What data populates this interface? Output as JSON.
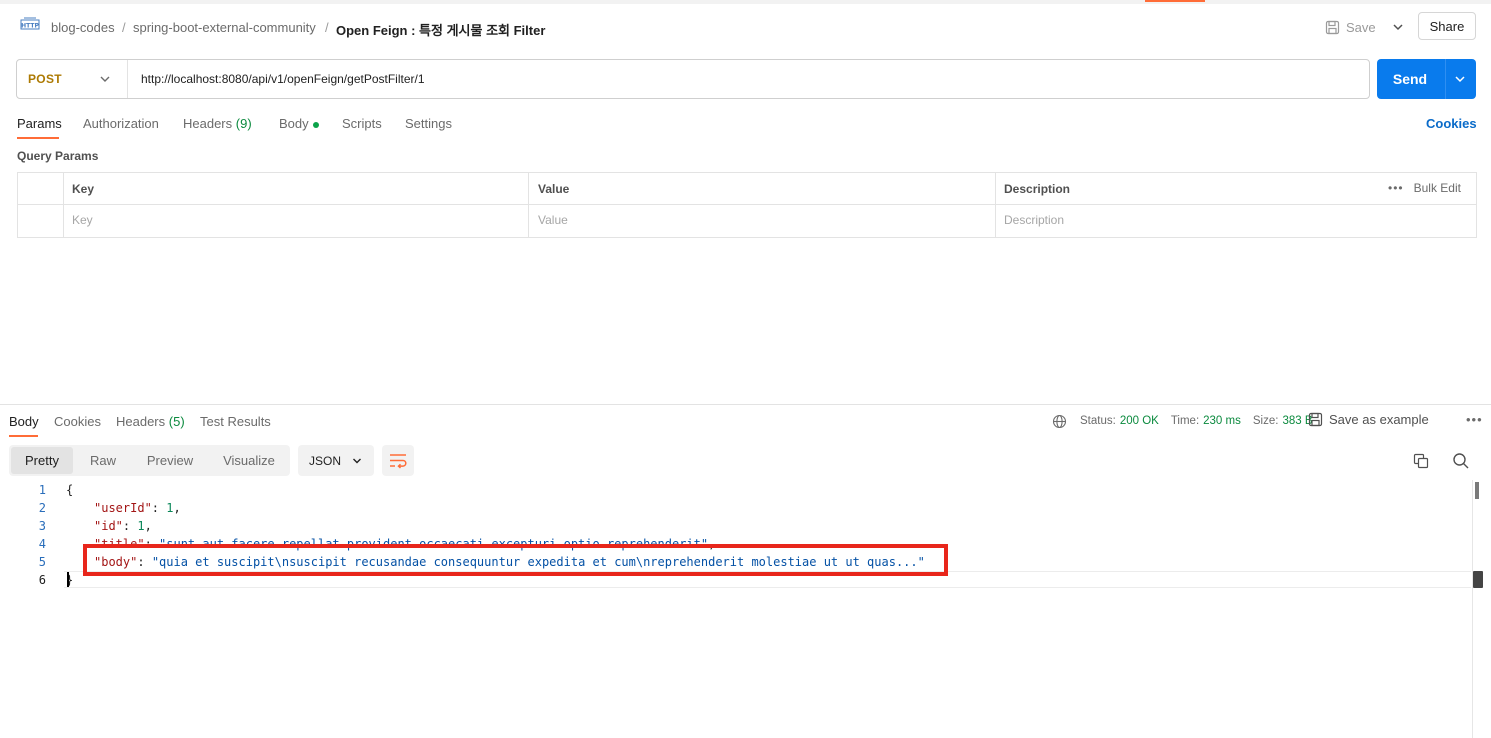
{
  "breadcrumb": {
    "items": [
      "blog-codes",
      "spring-boot-external-community"
    ],
    "separator": "/",
    "current": "Open Feign : 특정 게시물 조회 Filter"
  },
  "toolbar": {
    "save_label": "Save",
    "share_label": "Share"
  },
  "request": {
    "method": "POST",
    "url": "http://localhost:8080/api/v1/openFeign/getPostFilter/1",
    "send_label": "Send"
  },
  "request_tabs": {
    "params": "Params",
    "authorization": "Authorization",
    "headers_label": "Headers",
    "headers_count": "(9)",
    "body": "Body",
    "scripts": "Scripts",
    "settings": "Settings",
    "cookies": "Cookies"
  },
  "query_params": {
    "title": "Query Params",
    "headers": {
      "key": "Key",
      "value": "Value",
      "description": "Description"
    },
    "placeholders": {
      "key": "Key",
      "value": "Value",
      "description": "Description"
    },
    "bulk_edit": "Bulk Edit"
  },
  "response_tabs": {
    "body": "Body",
    "cookies": "Cookies",
    "headers_label": "Headers",
    "headers_count": "(5)",
    "test_results": "Test Results"
  },
  "response_meta": {
    "status_label": "Status:",
    "status_value": "200 OK",
    "time_label": "Time:",
    "time_value": "230 ms",
    "size_label": "Size:",
    "size_value": "383 B",
    "save_example": "Save as example"
  },
  "view_modes": {
    "pretty": "Pretty",
    "raw": "Raw",
    "preview": "Preview",
    "visualize": "Visualize",
    "format": "JSON"
  },
  "code": {
    "line_numbers": [
      "1",
      "2",
      "3",
      "4",
      "5",
      "6"
    ],
    "open_brace": "{",
    "close_brace": "}",
    "lines": [
      {
        "key": "\"userId\"",
        "sep": ": ",
        "value": "1",
        "end": ","
      },
      {
        "key": "\"id\"",
        "sep": ": ",
        "value": "1",
        "end": ","
      },
      {
        "key": "\"title\"",
        "sep": ": ",
        "value": "\"sunt aut facere repellat provident occaecati excepturi optio reprehenderit\"",
        "end": ","
      },
      {
        "key": "\"body\"",
        "sep": ": ",
        "value": "\"quia et suscipit\\nsuscipit recusandae consequuntur expedita et cum\\nreprehenderit molestiae ut ut quas...\"",
        "end": ""
      }
    ]
  },
  "colors": {
    "accent": "#ff6c37",
    "send": "#097bed",
    "method": "#ad7a03",
    "status_ok": "#0b8a3e",
    "highlight_box": "#e8261b"
  }
}
